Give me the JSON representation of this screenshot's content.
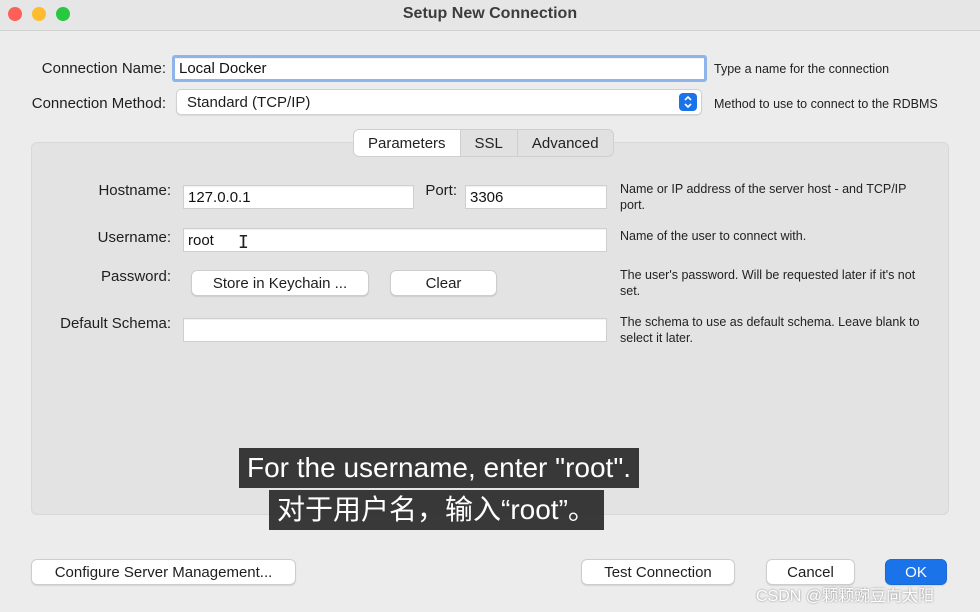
{
  "window": {
    "title": "Setup New Connection"
  },
  "connection_name": {
    "label": "Connection Name:",
    "value": "Local Docker",
    "hint": "Type a name for the connection"
  },
  "connection_method": {
    "label": "Connection Method:",
    "value": "Standard (TCP/IP)",
    "hint": "Method to use to connect to the RDBMS"
  },
  "tabs": [
    {
      "label": "Parameters"
    },
    {
      "label": "SSL"
    },
    {
      "label": "Advanced"
    }
  ],
  "params": {
    "hostname": {
      "label": "Hostname:",
      "value": "127.0.0.1"
    },
    "port": {
      "label": "Port:",
      "value": "3306"
    },
    "hostname_hint": "Name or IP address of the server host - and TCP/IP port.",
    "username": {
      "label": "Username:",
      "value": "root",
      "hint": "Name of the user to connect with."
    },
    "password": {
      "label": "Password:",
      "store_label": "Store in Keychain ...",
      "clear_label": "Clear",
      "hint": "The user's password. Will be requested later if it's not set."
    },
    "schema": {
      "label": "Default Schema:",
      "value": "",
      "hint": "The schema to use as default schema. Leave blank to select it later."
    }
  },
  "footer": {
    "configure_label": "Configure Server Management...",
    "test_label": "Test Connection",
    "cancel_label": "Cancel",
    "ok_label": "OK"
  },
  "subtitles": {
    "en": "For the username, enter \"root\".",
    "zh": "对于用户名，输入“root”。"
  },
  "watermark": "CSDN @颗颗豌豆向太阳",
  "colors": {
    "accent": "#1a73e8",
    "focus_ring": "#8fb4ea"
  }
}
